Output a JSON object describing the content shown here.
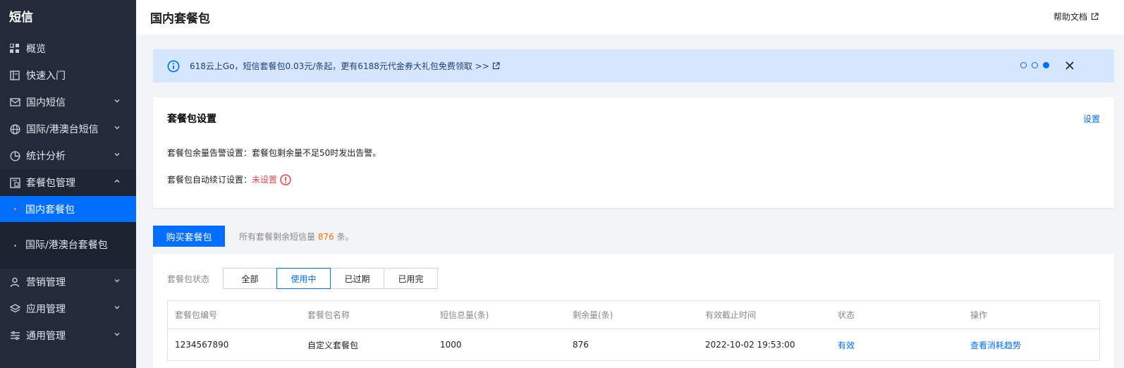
{
  "sidebar": {
    "title": "短信",
    "items": [
      {
        "label": "概览"
      },
      {
        "label": "快速入门"
      },
      {
        "label": "国内短信"
      },
      {
        "label": "国际/港澳台短信"
      },
      {
        "label": "统计分析"
      },
      {
        "label": "套餐包管理"
      },
      {
        "label": "营销管理"
      },
      {
        "label": "应用管理"
      },
      {
        "label": "通用管理"
      }
    ],
    "sub_items": [
      {
        "label": "国内套餐包"
      },
      {
        "label": "国际/港澳台套餐包"
      }
    ]
  },
  "header": {
    "title": "国内套餐包",
    "help_label": "帮助文档"
  },
  "notice": {
    "text": "618云上Go，短信套餐包0.03元/条起，更有6188元代金券大礼包免费领取 >>",
    "page_count": 3,
    "active_page": 3
  },
  "settings_card": {
    "title": "套餐包设置",
    "action_label": "设置",
    "alert_label": "套餐包余量告警设置：",
    "alert_value": "套餐包剩余量不足50时发出告警。",
    "renew_label": "套餐包自动续订设置：",
    "renew_value": "未设置"
  },
  "buy": {
    "button_label": "购买套餐包",
    "summary_prefix": "所有套餐剩余短信量",
    "summary_count": "876",
    "summary_suffix": "条。"
  },
  "filters": {
    "label": "套餐包状态",
    "options": [
      "全部",
      "使用中",
      "已过期",
      "已用完"
    ],
    "selected": "使用中"
  },
  "table": {
    "columns": [
      "套餐包编号",
      "套餐包名称",
      "短信总量(条)",
      "剩余量(条)",
      "有效截止时间",
      "状态",
      "操作"
    ],
    "rows": [
      {
        "id": "1234567890",
        "name": "自定义套餐包",
        "total": "1000",
        "remaining": "876",
        "expires": "2022-10-02 19:53:00",
        "status": "有效",
        "action": "查看消耗趋势"
      }
    ]
  },
  "colors": {
    "sidebar_bg": "#232a3a",
    "accent": "#006eff",
    "notice_bg": "#d5e7ff",
    "warning": "#e54545",
    "highlight": "#ff7200"
  }
}
